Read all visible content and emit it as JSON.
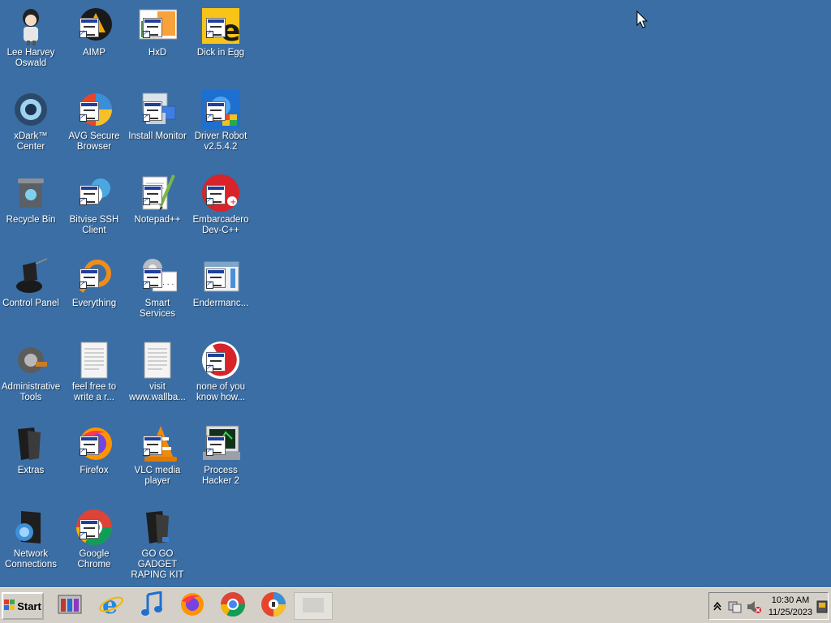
{
  "desktop": {
    "background": "#3a6ea5",
    "icons": [
      {
        "label": "Lee Harvey Oswald",
        "icon": "figure-icon"
      },
      {
        "label": "AIMP",
        "icon": "aimp-icon"
      },
      {
        "label": "HxD",
        "icon": "hxd-icon"
      },
      {
        "label": "Dick in Egg",
        "icon": "egg-icon"
      },
      {
        "label": "xDark™ Center",
        "icon": "xdark-icon"
      },
      {
        "label": "AVG Secure Browser",
        "icon": "avg-browser-icon"
      },
      {
        "label": "Install Monitor",
        "icon": "install-monitor-icon"
      },
      {
        "label": "Driver Robot v2.5.4.2",
        "icon": "driver-robot-icon"
      },
      {
        "label": "Recycle Bin",
        "icon": "recycle-bin-icon"
      },
      {
        "label": "Bitvise SSH Client",
        "icon": "bitvise-icon"
      },
      {
        "label": "Notepad++",
        "icon": "notepad-icon"
      },
      {
        "label": "Embarcadero Dev-C++",
        "icon": "devcpp-icon"
      },
      {
        "label": "Control Panel",
        "icon": "control-panel-icon"
      },
      {
        "label": "Everything",
        "icon": "everything-icon"
      },
      {
        "label": "Smart Services",
        "icon": "smart-services-icon"
      },
      {
        "label": "Endermanc...",
        "icon": "window-icon"
      },
      {
        "label": "Administrative Tools",
        "icon": "admin-tools-icon"
      },
      {
        "label": "feel free to write a r...",
        "icon": "text-document-icon"
      },
      {
        "label": "visit www.wallba...",
        "icon": "text-document-icon"
      },
      {
        "label": "none of you know how...",
        "icon": "red-circle-icon"
      },
      {
        "label": "Extras",
        "icon": "folder-icon"
      },
      {
        "label": "Firefox",
        "icon": "firefox-icon"
      },
      {
        "label": "VLC media player",
        "icon": "vlc-icon"
      },
      {
        "label": "Process Hacker 2",
        "icon": "process-hacker-icon"
      },
      {
        "label": "Network Connections",
        "icon": "network-icon"
      },
      {
        "label": "Google Chrome",
        "icon": "chrome-icon"
      },
      {
        "label": "GO GO GADGET RAPING KIT",
        "icon": "folder-icon"
      }
    ]
  },
  "taskbar": {
    "start_label": "Start",
    "pinned": [
      {
        "icon": "app-stack-icon"
      },
      {
        "icon": "internet-explorer-icon"
      },
      {
        "icon": "music-note-icon"
      },
      {
        "icon": "firefox-icon"
      },
      {
        "icon": "chrome-icon"
      },
      {
        "icon": "avg-browser-icon"
      },
      {
        "icon": "blank-window-icon"
      }
    ],
    "tray": {
      "time": "10:30 AM",
      "date": "11/25/2023"
    }
  }
}
